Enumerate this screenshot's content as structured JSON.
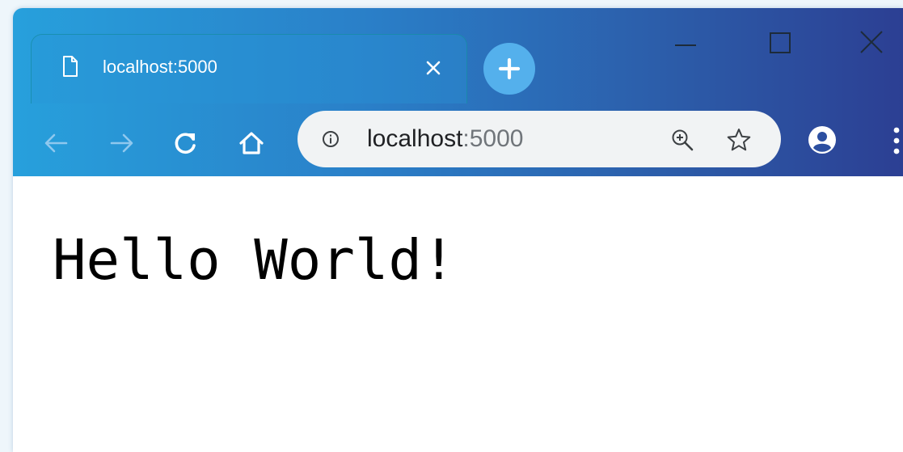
{
  "browser": {
    "tab": {
      "title": "localhost:5000",
      "page_icon": "page-icon",
      "close_icon": "close-icon"
    },
    "new_tab_icon": "plus-icon",
    "window_controls": [
      "minimize-icon",
      "maximize-icon",
      "close-window-icon"
    ],
    "toolbar": {
      "back_icon": "arrow-left-icon",
      "forward_icon": "arrow-right-icon",
      "reload_icon": "reload-icon",
      "home_icon": "home-icon",
      "address_bar": {
        "info_icon": "info-icon",
        "url_host": "localhost",
        "url_port": ":5000",
        "zoom_icon": "zoom-in-icon",
        "bookmark_icon": "star-icon"
      },
      "profile_icon": "account-icon",
      "menu_icon": "more-vert-icon"
    }
  },
  "page": {
    "heading": "Hello World!"
  },
  "colors": {
    "frame_start": "#27a0dc",
    "frame_end": "#2c3f93",
    "new_tab_button": "#54b0ec",
    "omnibox": "#f1f3f4",
    "content_bg": "#ffffff"
  }
}
